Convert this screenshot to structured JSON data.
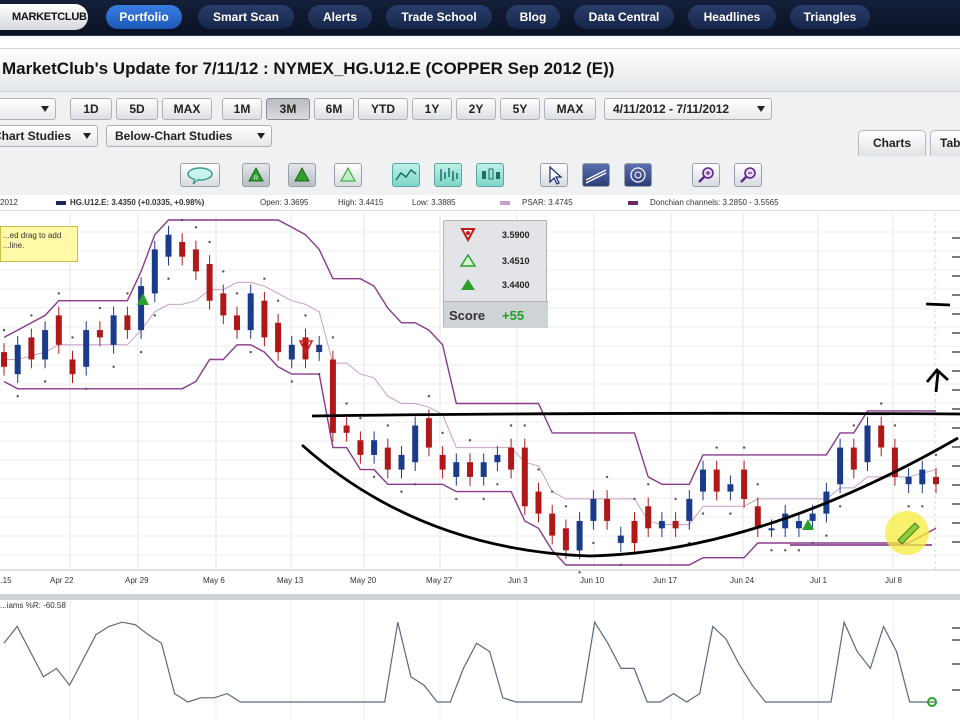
{
  "nav": {
    "logo": "MARKETCLUB",
    "tabs": [
      "Portfolio",
      "Smart Scan",
      "Alerts",
      "Trade School",
      "Blog",
      "Data Central",
      "Headlines",
      "Triangles"
    ],
    "active_tab": "Portfolio"
  },
  "page_title": "MarketClub's Update for 7/11/12 : NYMEX_HG.U12.E (COPPER Sep 2012 (E))",
  "toolbar": {
    "periods_a": [
      "1D",
      "5D",
      "MAX"
    ],
    "periods_b": [
      "1M",
      "3M",
      "6M",
      "YTD",
      "1Y",
      "2Y",
      "5Y",
      "MAX"
    ],
    "selected_period": "3M",
    "date_range": "4/11/2012 - 7/11/2012",
    "chart_studies": "Chart Studies",
    "below_chart_studies": "Below-Chart Studies",
    "view_tabs": [
      "Charts",
      "Tab"
    ]
  },
  "legend": {
    "year": "2012",
    "symbol": "HG.U12.E: 3.4350 (+0.0335, +0.98%)",
    "open": "Open: 3.3695",
    "high": "High: 3.4415",
    "low": "Low: 3.3885",
    "psar": "PSAR: 3.4745",
    "donchian": "Donchian channels: 3.2850 - 3.5565"
  },
  "tooltip": {
    "line1": "...ed drag to add",
    "line2": "...line."
  },
  "signals": {
    "rows": [
      {
        "icon": "red-triangle-down-icon",
        "value": "3.5900"
      },
      {
        "icon": "green-triangle-outline-icon",
        "value": "3.4510"
      },
      {
        "icon": "green-triangle-up-icon",
        "value": "3.4400"
      }
    ],
    "score_label": "Score",
    "score_value": "+55"
  },
  "williams_label": "...iams %R: -60.58",
  "colors": {
    "up_candle": "#1a3a8a",
    "down_candle": "#b01818",
    "donchian": "#8a3a8a",
    "psar": "#555555",
    "nav_active": "#2a6ed0",
    "score_positive": "#20a020"
  },
  "chart_data": {
    "type": "candlestick",
    "x_tick_labels": [
      "...15",
      "Apr 22",
      "Apr 29",
      "May 6",
      "May 13",
      "May 20",
      "May 27",
      "Jun 3",
      "Jun 10",
      "Jun 17",
      "Jun 24",
      "Jul 1",
      "Jul 8"
    ],
    "symbol": "HG.U12.E",
    "last_close": 3.435,
    "change": 0.0335,
    "change_pct": 0.98,
    "open": 3.3695,
    "high": 3.4415,
    "low": 3.3885,
    "psar": 3.4745,
    "donchian_low": 3.285,
    "donchian_high": 3.5565,
    "grid": true,
    "candles": [
      {
        "o": 3.81,
        "c": 3.79
      },
      {
        "o": 3.78,
        "c": 3.82
      },
      {
        "o": 3.83,
        "c": 3.8
      },
      {
        "o": 3.8,
        "c": 3.84
      },
      {
        "o": 3.86,
        "c": 3.82
      },
      {
        "o": 3.8,
        "c": 3.78
      },
      {
        "o": 3.79,
        "c": 3.84
      },
      {
        "o": 3.84,
        "c": 3.83
      },
      {
        "o": 3.82,
        "c": 3.86
      },
      {
        "o": 3.86,
        "c": 3.84
      },
      {
        "o": 3.84,
        "c": 3.9
      },
      {
        "o": 3.89,
        "c": 3.95
      },
      {
        "o": 3.94,
        "c": 3.97
      },
      {
        "o": 3.96,
        "c": 3.94
      },
      {
        "o": 3.95,
        "c": 3.92
      },
      {
        "o": 3.93,
        "c": 3.88
      },
      {
        "o": 3.89,
        "c": 3.86
      },
      {
        "o": 3.86,
        "c": 3.84
      },
      {
        "o": 3.84,
        "c": 3.89
      },
      {
        "o": 3.88,
        "c": 3.83
      },
      {
        "o": 3.85,
        "c": 3.81
      },
      {
        "o": 3.8,
        "c": 3.82
      },
      {
        "o": 3.83,
        "c": 3.8
      },
      {
        "o": 3.81,
        "c": 3.82
      },
      {
        "o": 3.8,
        "c": 3.7
      },
      {
        "o": 3.71,
        "c": 3.7
      },
      {
        "o": 3.69,
        "c": 3.67
      },
      {
        "o": 3.67,
        "c": 3.69
      },
      {
        "o": 3.68,
        "c": 3.65
      },
      {
        "o": 3.65,
        "c": 3.67
      },
      {
        "o": 3.66,
        "c": 3.71
      },
      {
        "o": 3.72,
        "c": 3.68
      },
      {
        "o": 3.67,
        "c": 3.65
      },
      {
        "o": 3.64,
        "c": 3.66
      },
      {
        "o": 3.66,
        "c": 3.64
      },
      {
        "o": 3.64,
        "c": 3.66
      },
      {
        "o": 3.66,
        "c": 3.67
      },
      {
        "o": 3.68,
        "c": 3.65
      },
      {
        "o": 3.68,
        "c": 3.6
      },
      {
        "o": 3.62,
        "c": 3.59
      },
      {
        "o": 3.59,
        "c": 3.56
      },
      {
        "o": 3.57,
        "c": 3.54
      },
      {
        "o": 3.54,
        "c": 3.58
      },
      {
        "o": 3.58,
        "c": 3.61
      },
      {
        "o": 3.61,
        "c": 3.58
      },
      {
        "o": 3.55,
        "c": 3.56
      },
      {
        "o": 3.58,
        "c": 3.55
      },
      {
        "o": 3.6,
        "c": 3.57
      },
      {
        "o": 3.57,
        "c": 3.58
      },
      {
        "o": 3.58,
        "c": 3.57
      },
      {
        "o": 3.58,
        "c": 3.61
      },
      {
        "o": 3.62,
        "c": 3.65
      },
      {
        "o": 3.65,
        "c": 3.62
      },
      {
        "o": 3.62,
        "c": 3.63
      },
      {
        "o": 3.65,
        "c": 3.61
      },
      {
        "o": 3.6,
        "c": 3.57
      },
      {
        "o": 3.57,
        "c": 3.57
      },
      {
        "o": 3.57,
        "c": 3.59
      },
      {
        "o": 3.57,
        "c": 3.58
      },
      {
        "o": 3.58,
        "c": 3.59
      },
      {
        "o": 3.59,
        "c": 3.62
      },
      {
        "o": 3.63,
        "c": 3.68
      },
      {
        "o": 3.68,
        "c": 3.65
      },
      {
        "o": 3.66,
        "c": 3.71
      },
      {
        "o": 3.71,
        "c": 3.68
      },
      {
        "o": 3.68,
        "c": 3.64
      },
      {
        "o": 3.63,
        "c": 3.64
      },
      {
        "o": 3.63,
        "c": 3.65
      },
      {
        "o": 3.64,
        "c": 3.63
      }
    ],
    "williams_r": [
      -30,
      -10,
      -40,
      -70,
      -60,
      -80,
      -50,
      -20,
      -10,
      -5,
      -8,
      -20,
      -30,
      -90,
      -100,
      -95,
      -95,
      -90,
      -100,
      -100,
      -100,
      -100,
      -100,
      -100,
      -100,
      -100,
      -100,
      -100,
      -100,
      -100,
      -5,
      -70,
      -80,
      -100,
      -100,
      -60,
      -30,
      -40,
      -95,
      -100,
      -100,
      -100,
      -100,
      -100,
      -100,
      -5,
      -30,
      -60,
      -60,
      -100,
      -100,
      -90,
      -100,
      -90,
      -10,
      -25,
      -55,
      -80,
      -100,
      -100,
      -100,
      -100,
      -100,
      -100,
      -5,
      -40,
      -60,
      -10,
      -40,
      -100,
      -100,
      -100
    ]
  }
}
